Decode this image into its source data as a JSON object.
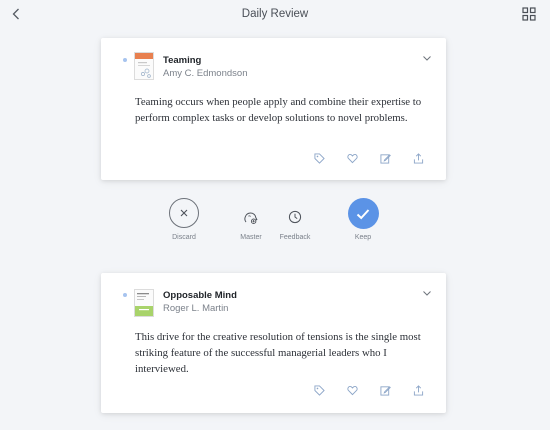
{
  "header": {
    "title": "Daily Review",
    "back_icon": "chevron-left-icon",
    "grid_icon": "grid-icon"
  },
  "highlights": [
    {
      "book_title": "Teaming",
      "author": "Amy C. Edmondson",
      "quote": "Teaming occurs when people apply and combine their expertise to perform complex tasks or develop solutions to novel problems.",
      "cover_accent": "#e8804f"
    },
    {
      "book_title": "Opposable Mind",
      "author": "Roger L. Martin",
      "quote": "This drive for the creative resolution of tensions is the single most striking feature of the successful managerial leaders who I interviewed.",
      "cover_accent": "#a8d36a"
    }
  ],
  "card_actions": [
    "tag-icon",
    "heart-icon",
    "edit-icon",
    "share-icon"
  ],
  "review_actions": {
    "discard": "Discard",
    "master": "Master",
    "feedback": "Feedback",
    "keep": "Keep"
  },
  "colors": {
    "accent": "#5b93e6",
    "dot": "#a7c4ef",
    "icon": "#8da6c8",
    "background": "#f3f5f8"
  }
}
